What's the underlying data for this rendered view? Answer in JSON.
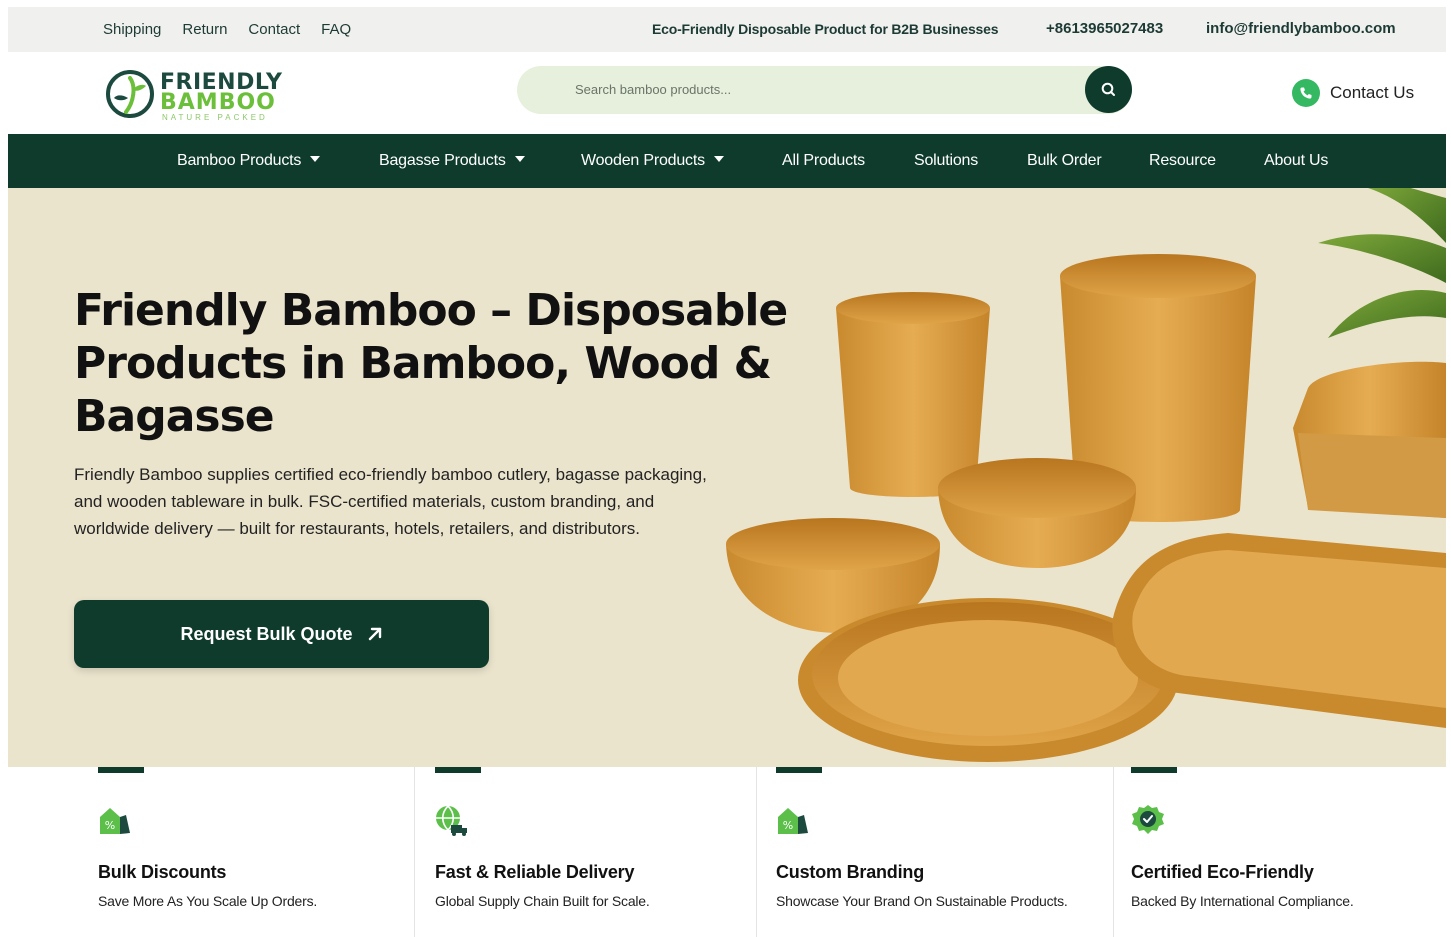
{
  "topbar": {
    "links": [
      "Shipping",
      "Return",
      "Contact",
      "FAQ"
    ],
    "tagline": "Eco-Friendly Disposable Product for B2B Businesses",
    "phone": "+8613965027483",
    "email": "info@friendlybamboo.com"
  },
  "header": {
    "logo": {
      "line1": "FRIENDLY",
      "line2": "BAMBOO",
      "line3": "NATURE PACKED"
    },
    "search": {
      "placeholder": "Search bamboo products..."
    },
    "contact_label": "Contact Us"
  },
  "nav": {
    "items": [
      {
        "label": "Bamboo Products",
        "dropdown": true
      },
      {
        "label": "Bagasse Products",
        "dropdown": true
      },
      {
        "label": "Wooden Products",
        "dropdown": true
      },
      {
        "label": "All Products",
        "dropdown": false
      },
      {
        "label": "Solutions",
        "dropdown": false
      },
      {
        "label": "Bulk Order",
        "dropdown": false
      },
      {
        "label": "Resource",
        "dropdown": false
      },
      {
        "label": "About Us",
        "dropdown": false
      }
    ]
  },
  "hero": {
    "title": "Friendly Bamboo – Disposable Products in Bamboo, Wood & Bagasse",
    "description": "Friendly Bamboo supplies certified eco-friendly bamboo cutlery, bagasse packaging, and wooden tableware in bulk. FSC-certified materials, custom branding, and worldwide delivery — built for restaurants, hotels, retailers, and distributors.",
    "cta_label": "Request Bulk Quote"
  },
  "features": [
    {
      "icon": "discount-tag-icon",
      "title": "Bulk Discounts",
      "description": "Save More As You Scale Up Orders."
    },
    {
      "icon": "globe-delivery-icon",
      "title": "Fast & Reliable Delivery",
      "description": "Global Supply Chain Built for Scale."
    },
    {
      "icon": "discount-tag-icon",
      "title": "Custom Branding",
      "description": "Showcase Your Brand On Sustainable Products."
    },
    {
      "icon": "certified-badge-icon",
      "title": "Certified Eco-Friendly",
      "description": "Backed By International Compliance."
    }
  ],
  "colors": {
    "brand_dark_green": "#0e3b2c",
    "brand_light_green": "#6cbf3b",
    "hero_background": "#ebe4cd",
    "search_background": "#e7f0dc"
  }
}
